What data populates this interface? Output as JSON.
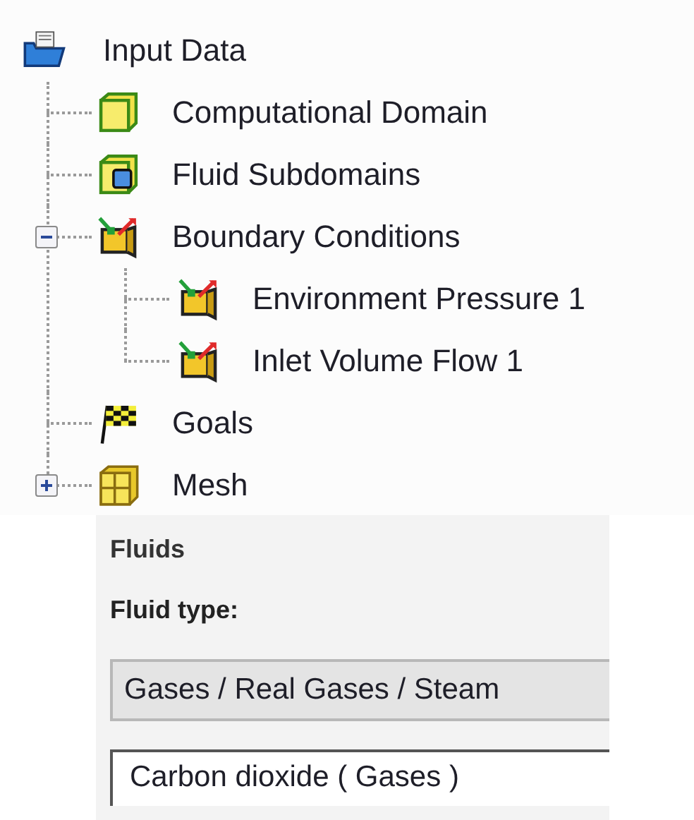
{
  "tree": [
    {
      "label": "Input Data",
      "kind": "folder",
      "children": [
        {
          "label": "Computational Domain",
          "kind": "box"
        },
        {
          "label": "Fluid Subdomains",
          "kind": "subdomain"
        },
        {
          "label": "Boundary Conditions",
          "kind": "boundary",
          "expanded": true,
          "children": [
            {
              "label": "Environment Pressure 1",
              "kind": "boundary"
            },
            {
              "label": "Inlet Volume Flow 1",
              "kind": "boundary"
            }
          ]
        },
        {
          "label": "Goals",
          "kind": "flag"
        },
        {
          "label": "Mesh",
          "kind": "mesh",
          "expanded": false
        }
      ]
    }
  ],
  "fluids": {
    "title": "Fluids",
    "type_label": "Fluid type:",
    "type_value": "Gases / Real Gases / Steam",
    "fluid": "Carbon dioxide ( Gases )"
  }
}
